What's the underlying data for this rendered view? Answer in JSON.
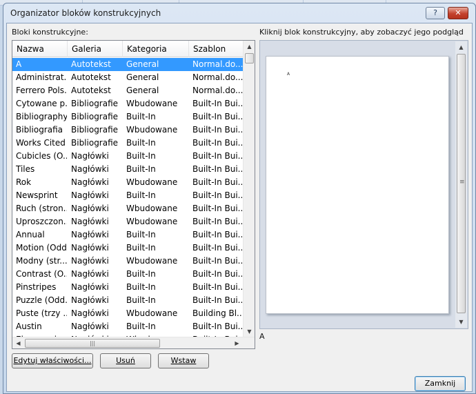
{
  "window": {
    "title": "Organizator bloków konstrukcyjnych",
    "help_label": "?",
    "close_label": "✕"
  },
  "list": {
    "label": "Bloki konstrukcyjne:",
    "columns": [
      "Nazwa",
      "Galeria",
      "Kategoria",
      "Szablon"
    ],
    "rows": [
      {
        "name": "A",
        "gallery": "Autotekst",
        "category": "General",
        "template": "Normal.do...",
        "selected": true
      },
      {
        "name": "Administrat...",
        "gallery": "Autotekst",
        "category": "General",
        "template": "Normal.do..."
      },
      {
        "name": "Ferrero Pols...",
        "gallery": "Autotekst",
        "category": "General",
        "template": "Normal.do..."
      },
      {
        "name": "Cytowane p...",
        "gallery": "Bibliografie",
        "category": "Wbudowane",
        "template": "Built-In Bui..."
      },
      {
        "name": "Bibliography",
        "gallery": "Bibliografie",
        "category": "Built-In",
        "template": "Built-In Bui..."
      },
      {
        "name": "Bibliografia",
        "gallery": "Bibliografie",
        "category": "Wbudowane",
        "template": "Built-In Bui..."
      },
      {
        "name": "Works Cited",
        "gallery": "Bibliografie",
        "category": "Built-In",
        "template": "Built-In Bui..."
      },
      {
        "name": "Cubicles (O...",
        "gallery": "Nagłówki",
        "category": "Built-In",
        "template": "Built-In Bui..."
      },
      {
        "name": "Tiles",
        "gallery": "Nagłówki",
        "category": "Built-In",
        "template": "Built-In Bui..."
      },
      {
        "name": "Rok",
        "gallery": "Nagłówki",
        "category": "Wbudowane",
        "template": "Built-In Bui..."
      },
      {
        "name": "Newsprint",
        "gallery": "Nagłówki",
        "category": "Built-In",
        "template": "Built-In Bui..."
      },
      {
        "name": "Ruch (stron...",
        "gallery": "Nagłówki",
        "category": "Wbudowane",
        "template": "Built-In Bui..."
      },
      {
        "name": "Uproszczon...",
        "gallery": "Nagłówki",
        "category": "Wbudowane",
        "template": "Built-In Bui..."
      },
      {
        "name": "Annual",
        "gallery": "Nagłówki",
        "category": "Built-In",
        "template": "Built-In Bui..."
      },
      {
        "name": "Motion (Odd...",
        "gallery": "Nagłówki",
        "category": "Built-In",
        "template": "Built-In Bui..."
      },
      {
        "name": "Modny (str...",
        "gallery": "Nagłówki",
        "category": "Wbudowane",
        "template": "Built-In Bui..."
      },
      {
        "name": "Contrast (O...",
        "gallery": "Nagłówki",
        "category": "Built-In",
        "template": "Built-In Bui..."
      },
      {
        "name": "Pinstripes",
        "gallery": "Nagłówki",
        "category": "Built-In",
        "template": "Built-In Bui..."
      },
      {
        "name": "Puzzle (Odd...",
        "gallery": "Nagłówki",
        "category": "Built-In",
        "template": "Built-In Bui..."
      },
      {
        "name": " Puste (trzy ...",
        "gallery": "Nagłówki",
        "category": "Wbudowane",
        "template": "Building Bl..."
      },
      {
        "name": "Austin",
        "gallery": "Nagłówki",
        "category": "Built-In",
        "template": "Built-In Bui..."
      },
      {
        "name": "Ekspozycja ...",
        "gallery": "Nagłówki",
        "category": "Wbudowane",
        "template": "Built-In Bui..."
      }
    ]
  },
  "preview": {
    "label": "Kliknij blok konstrukcyjny, aby zobaczyć jego podgląd",
    "page_glyph": "A",
    "caption": "A"
  },
  "buttons": {
    "edit": "Edytuj właściwości...",
    "delete": "Usuń",
    "insert": "Wstaw",
    "close": "Zamknij"
  },
  "icons": {
    "scroll_up": "▲",
    "scroll_down": "▼",
    "scroll_left": "◀",
    "scroll_right": "▶",
    "grip_v": "≡",
    "grip_h": "|||"
  }
}
